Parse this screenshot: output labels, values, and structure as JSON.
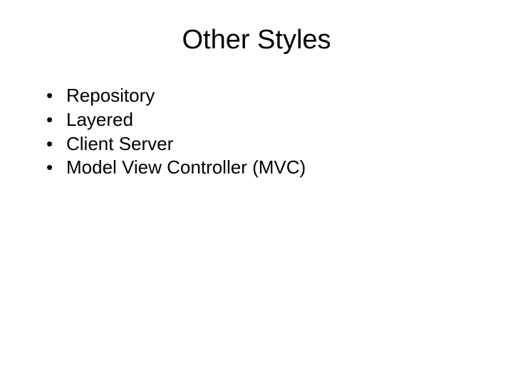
{
  "title": "Other Styles",
  "bullets": {
    "item0": "Repository",
    "item1": "Layered",
    "item2": "Client Server",
    "item3": "Model View Controller (MVC)"
  }
}
